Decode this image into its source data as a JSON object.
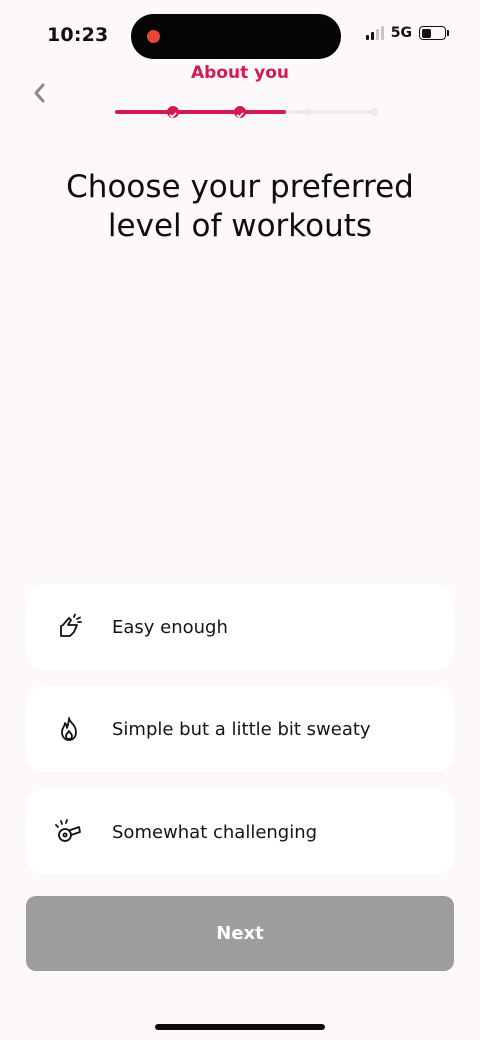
{
  "status_bar": {
    "time": "10:23",
    "network": "5G"
  },
  "header": {
    "section": "About you"
  },
  "progress": {
    "completed_steps": 2,
    "total_steps": 4
  },
  "title": "Choose your preferred\nlevel of workouts",
  "options": [
    {
      "label": "Easy enough",
      "icon": "pointing-hand-icon"
    },
    {
      "label": "Simple but a little bit sweaty",
      "icon": "flame-icon"
    },
    {
      "label": "Somewhat challenging",
      "icon": "whistle-icon"
    }
  ],
  "next_button": {
    "label": "Next"
  },
  "colors": {
    "accent": "#d41a4e",
    "disabled_button": "#9d9c9f",
    "background": "#fcf8fb"
  }
}
